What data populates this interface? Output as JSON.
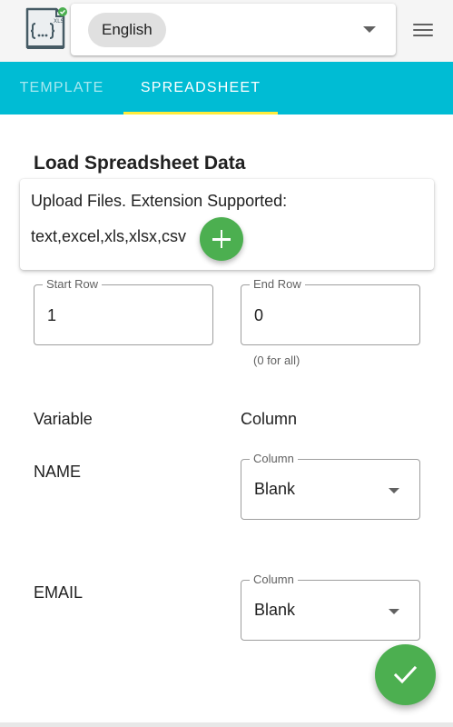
{
  "header": {
    "logo_icon": "spreadsheet-code-logo-icon",
    "logo_label": "XLS",
    "language": {
      "selected": "English"
    },
    "menu_icon": "hamburger-menu-icon"
  },
  "tabs": [
    {
      "label": "TEMPLATE",
      "active": false
    },
    {
      "label": "SPREADSHEET",
      "active": true
    }
  ],
  "colors": {
    "tab_bar": "#00bcd4",
    "tab_indicator": "#ffeb3b",
    "fab": "#4caf50"
  },
  "main": {
    "title": "Load Spreadsheet Data",
    "upload": {
      "line1": "Upload Files. Extension Supported:",
      "line2": "text,excel,xls,xlsx,csv",
      "add_icon": "plus-icon"
    },
    "start_row": {
      "label": "Start Row",
      "value": "1"
    },
    "end_row": {
      "label": "End Row",
      "value": "0",
      "helper": "(0 for all)"
    },
    "mapping": {
      "variable_header": "Variable",
      "column_header": "Column",
      "rows": [
        {
          "variable": "NAME",
          "column_label": "Column",
          "column_value": "Blank"
        },
        {
          "variable": "EMAIL",
          "column_label": "Column",
          "column_value": "Blank"
        }
      ]
    },
    "confirm_icon": "checkmark-icon"
  }
}
